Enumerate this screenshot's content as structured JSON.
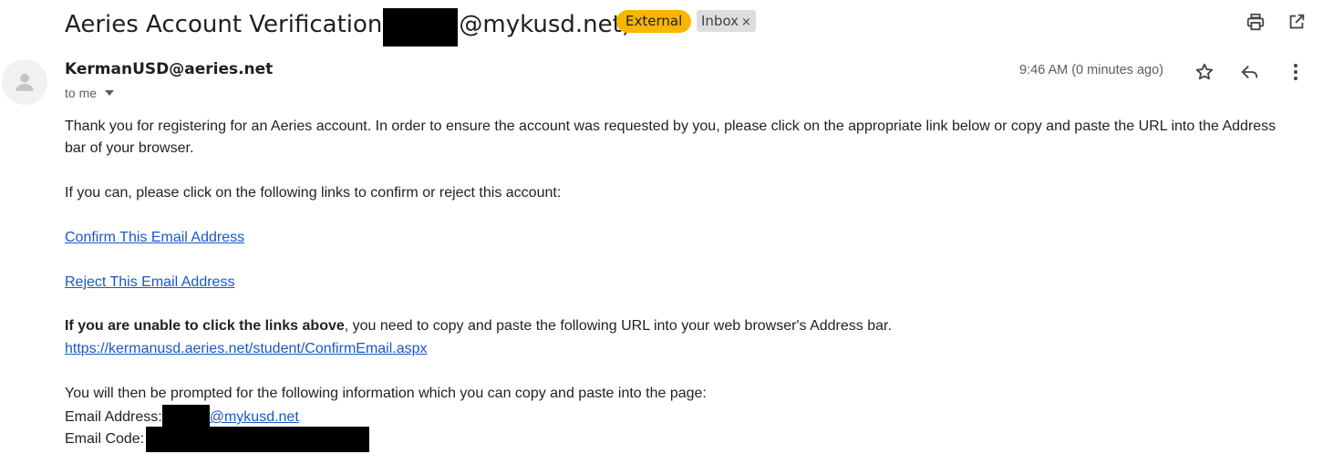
{
  "email": {
    "subject_prefix": "Aeries Account Verification",
    "subject_suffix": "@mykusd.net)",
    "label_external": "External",
    "label_inbox": "Inbox",
    "label_inbox_close": "×",
    "sender": "KermanUSD@aeries.net",
    "recipient": "to me",
    "time": "9:46 AM (0 minutes ago)"
  },
  "body": {
    "para1_line1": "Thank you for registering for an Aeries account. In order to ensure the account was requested by you, please click on the appropriate link below or copy and paste the URL into the Address",
    "para1_line2": "bar of your browser.",
    "para2": "If you can, please click on the following links to confirm or reject this account:",
    "confirm_link": "Confirm This Email Address",
    "reject_link": "Reject This Email Address",
    "para3_bold": "If you are unable to click the links above",
    "para3_rest": ", you need to copy and paste the following URL into your web browser's Address bar.",
    "url": "https://kermanusd.aeries.net/student/ConfirmEmail.aspx",
    "para4": "You will then be prompted for the following information which you can copy and paste into the page:",
    "email_label": "Email Address:",
    "email_domain": "@mykusd.net",
    "code_label": "Email Code:"
  },
  "icons": {
    "print": "print-icon",
    "open_new_window": "open-in-new-window-icon",
    "star": "star-icon",
    "reply": "reply-icon",
    "more": "more-vert-icon",
    "dropdown": "caret-down-icon",
    "avatar": "person-icon"
  }
}
